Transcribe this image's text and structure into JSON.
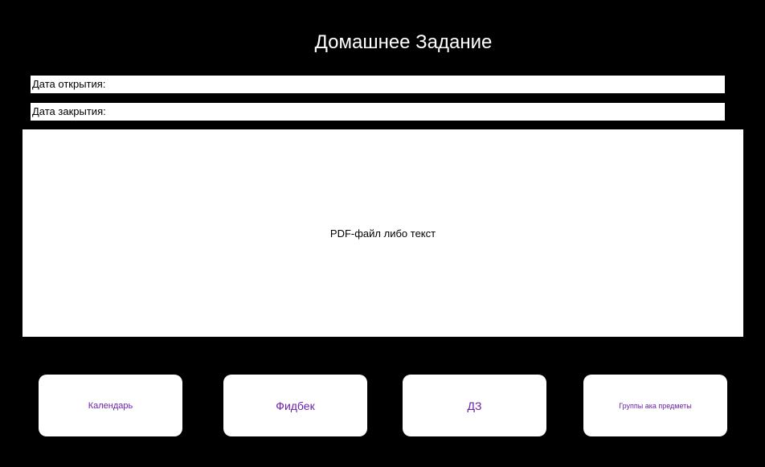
{
  "page": {
    "title": "Домашнее Задание"
  },
  "fields": {
    "open_date_label": "Дата открытия:",
    "close_date_label": "Дата закрытия:"
  },
  "content": {
    "placeholder": "PDF-файл либо текст"
  },
  "nav": {
    "calendar_label": "Календарь",
    "feedback_label": "Фидбек",
    "homework_label": "ДЗ",
    "groups_label": "Группы ака предметы"
  },
  "colors": {
    "background": "#000000",
    "surface": "#ffffff",
    "accent_text": "#6b21a8"
  }
}
